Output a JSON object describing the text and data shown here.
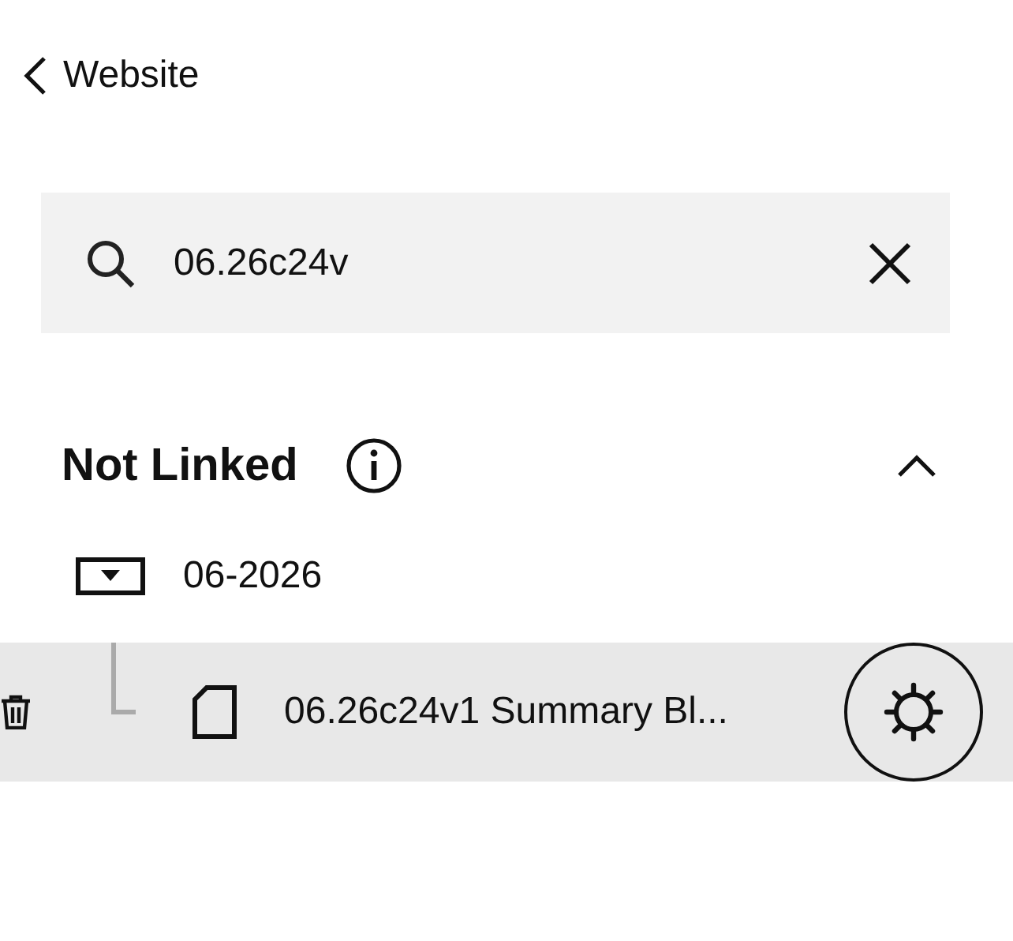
{
  "back_link": {
    "label": "Website"
  },
  "search": {
    "value": "06.26c24v"
  },
  "section": {
    "title": "Not Linked",
    "expanded": true,
    "folders": [
      {
        "name": "06-2026",
        "children": [
          {
            "name": "06.26c24v1 Summary Bl...",
            "selected": true
          }
        ]
      }
    ]
  }
}
